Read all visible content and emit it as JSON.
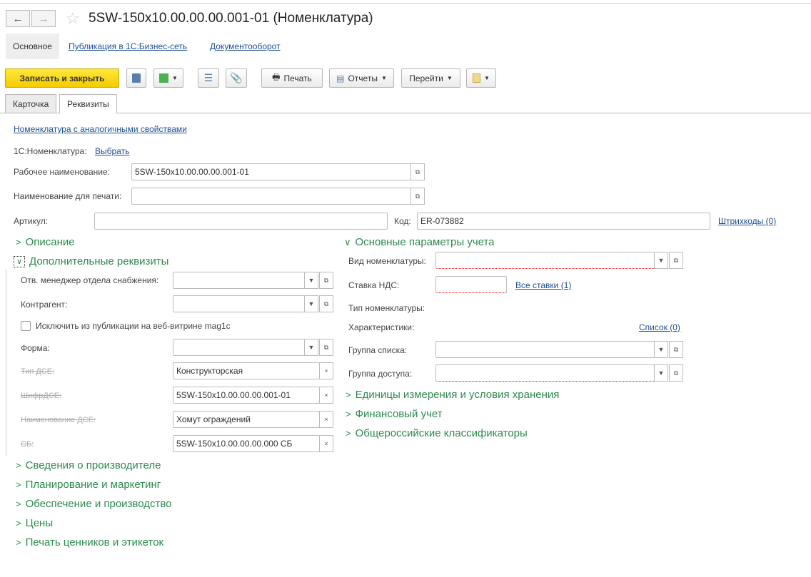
{
  "window": {
    "title": "5SW-150x10.00.00.00.001-01 (Номенклатура)"
  },
  "nav": {
    "back": "←",
    "forward": "→",
    "star": "☆"
  },
  "panel": {
    "items": [
      "Основное",
      "Публикация в 1С:Бизнес-сеть",
      "Документооборот"
    ]
  },
  "toolbar": {
    "save_close": "Записать и закрыть",
    "print": "Печать",
    "reports": "Отчеты",
    "goto": "Перейти"
  },
  "tabs": [
    "Карточка",
    "Реквизиты"
  ],
  "form": {
    "similar_link": "Номенклатура с аналогичными свойствами",
    "nom1c_label": "1С:Номенклатура:",
    "nom1c_link": "Выбрать",
    "work_name_label": "Рабочее наименование:",
    "work_name_value": "5SW-150x10.00.00.00.001-01",
    "print_name_label": "Наименование для печати:",
    "print_name_value": "",
    "article_label": "Артикул:",
    "article_value": "",
    "code_label": "Код:",
    "code_value": "ER-073882",
    "barcodes_link": "Штрихкоды (0)"
  },
  "left": {
    "description": "Описание",
    "extra": "Дополнительные реквизиты",
    "manager_label": "Отв. менеджер отдела снабжения:",
    "counterparty_label": "Контрагент:",
    "exclude_label": "Исключить из публикации на веб-витрине mag1c",
    "exclude_checked": false,
    "form_label": "Форма:",
    "dse_type_label": "Тип ДСЕ:",
    "dse_type_value": "Конструкторская",
    "dse_code_label": "ШифрДСЕ:",
    "dse_code_value": "5SW-150x10.00.00.00.001-01",
    "dse_name_label": "Наименование ДСЕ:",
    "dse_name_value": "Хомут ограждений",
    "sb_label": "СБ:",
    "sb_value": "5SW-150x10.00.00.00.000 СБ",
    "sections": [
      "Сведения о производителе",
      "Планирование и маркетинг",
      "Обеспечение и производство",
      "Цены",
      "Печать ценников и этикеток"
    ]
  },
  "right": {
    "main_params": "Основные параметры учета",
    "kind_label": "Вид номенклатуры:",
    "vat_label": "Ставка НДС:",
    "vat_link": "Все ставки (1)",
    "type_label": "Тип номенклатуры:",
    "chars_label": "Характеристики:",
    "chars_link": "Список (0)",
    "list_group_label": "Группа списка:",
    "access_group_label": "Группа доступа:",
    "sections": [
      "Единицы измерения и условия хранения",
      "Финансовый учет",
      "Общероссийские классификаторы"
    ]
  }
}
